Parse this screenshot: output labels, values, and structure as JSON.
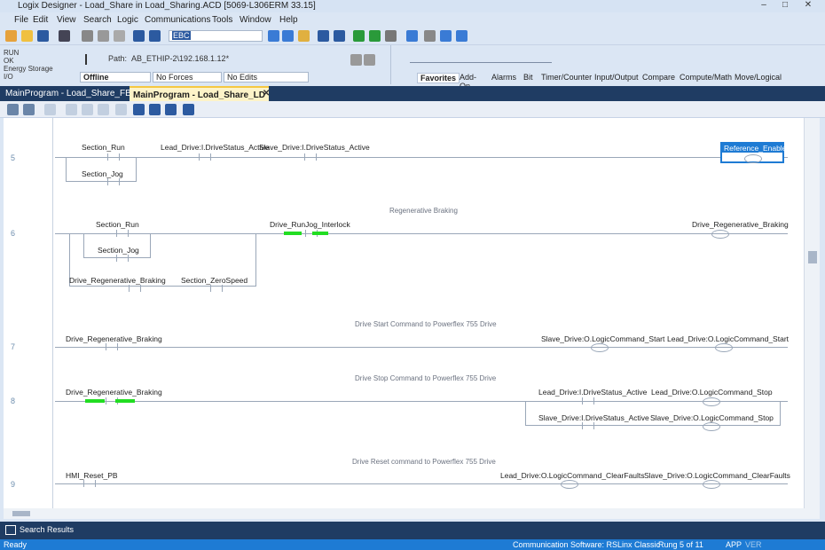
{
  "window": {
    "title": "Logix Designer - Load_Share in Load_Sharing.ACD [5069-L306ERM 33.15]",
    "min": "–",
    "max": "□",
    "close": "✕"
  },
  "menu": [
    "File",
    "Edit",
    "View",
    "Search",
    "Logic",
    "Communications",
    "Tools",
    "Window",
    "Help"
  ],
  "toolbar": {
    "search_value": "EBC"
  },
  "controller": {
    "run": "RUN",
    "ok": "OK",
    "energy": "Energy Storage",
    "io": "I/O",
    "mode": "Offline",
    "forces": "No Forces",
    "edits": "No Edits",
    "path_label": "Path:",
    "path": "AB_ETHIP-2\\192.168.1.12*"
  },
  "instruction_tabs": [
    "Favorites",
    "Add-On",
    "Alarms",
    "Bit",
    "Timer/Counter",
    "Input/Output",
    "Compare",
    "Compute/Math",
    "Move/Logical"
  ],
  "doc_tabs": [
    {
      "label": "MainProgram - Load_Share_FB"
    },
    {
      "label": "MainProgram - Load_Share_LD"
    }
  ],
  "rungs": [
    {
      "number": "5",
      "comment": "",
      "tags": [
        "Section_Run",
        "Lead_Drive:I.DriveStatus_Active",
        "Slave_Drive:I.DriveStatus_Active",
        "Section_Jog"
      ],
      "output": "Reference_Enable"
    },
    {
      "number": "6",
      "comment": "Regenerative Braking",
      "tags": [
        "Section_Run",
        "Drive_RunJog_Interlock",
        "Section_Jog",
        "Drive_Regenerative_Braking",
        "Section_ZeroSpeed"
      ],
      "output": "Drive_Regenerative_Braking"
    },
    {
      "number": "7",
      "comment": "Drive Start Command to Powerflex 755 Drive",
      "tags": [
        "Drive_Regenerative_Braking",
        "Slave_Drive:O.LogicCommand_Start"
      ],
      "output": "Lead_Drive:O.LogicCommand_Start"
    },
    {
      "number": "8",
      "comment": "Drive Stop Command to Powerflex 755 Drive",
      "tags": [
        "Drive_Regenerative_Braking",
        "Lead_Drive:I.DriveStatus_Active",
        "Lead_Drive:O.LogicCommand_Stop",
        "Slave_Drive:I.DriveStatus_Active"
      ],
      "output": "Slave_Drive:O.LogicCommand_Stop"
    },
    {
      "number": "9",
      "comment": "Drive Reset command to Powerflex 755 Drive",
      "tags": [
        "HMI_Reset_PB",
        "Lead_Drive:O.LogicCommand_ClearFaults"
      ],
      "output": "Slave_Drive:O.LogicCommand_ClearFaults"
    }
  ],
  "search_results": {
    "label": "Search Results"
  },
  "statusbar": {
    "left": "Ready",
    "comm": "Communication Software: RSLinx Classic",
    "rung": "Rung 5 of 11",
    "app": "APP",
    "ver": "VER"
  }
}
